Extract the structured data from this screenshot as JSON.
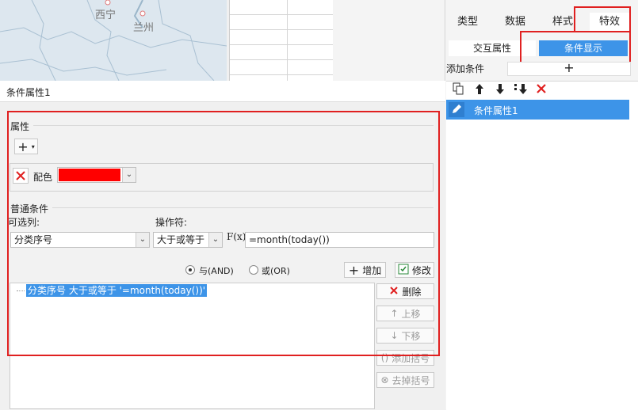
{
  "map": {
    "city1": "西宁",
    "city2": "兰州"
  },
  "right_panel": {
    "tabs": [
      "类型",
      "数据",
      "样式",
      "特效"
    ],
    "subtabs": [
      "交互属性",
      "条件显示"
    ],
    "add_condition_label": "添加条件",
    "add_symbol": "+",
    "list_items": [
      "条件属性1"
    ]
  },
  "left_panel": {
    "title": "条件属性1",
    "attr_section": "属性",
    "attr_add": "+",
    "color_label": "配色",
    "color_value": "#ff0000",
    "general_section": "普通条件",
    "optional_col_label": "可选列:",
    "operator_label": "操作符:",
    "col_value": "分类序号",
    "op_value": "大于或等于",
    "formula_icon": "F(x)",
    "formula_value": "=month(today())",
    "radio_and": "与(AND)",
    "radio_or": "或(OR)",
    "add_button": "增加",
    "modify_button": "修改",
    "condition_text": "分类序号 大于或等于 '=month(today())'",
    "delete_button": "删除",
    "move_up_button": "上移",
    "move_down_button": "下移",
    "add_bracket_button": "添加括号",
    "remove_bracket_button": "去掉括号"
  },
  "colors": {
    "accent": "#3d94e8",
    "highlight": "#e02020"
  }
}
